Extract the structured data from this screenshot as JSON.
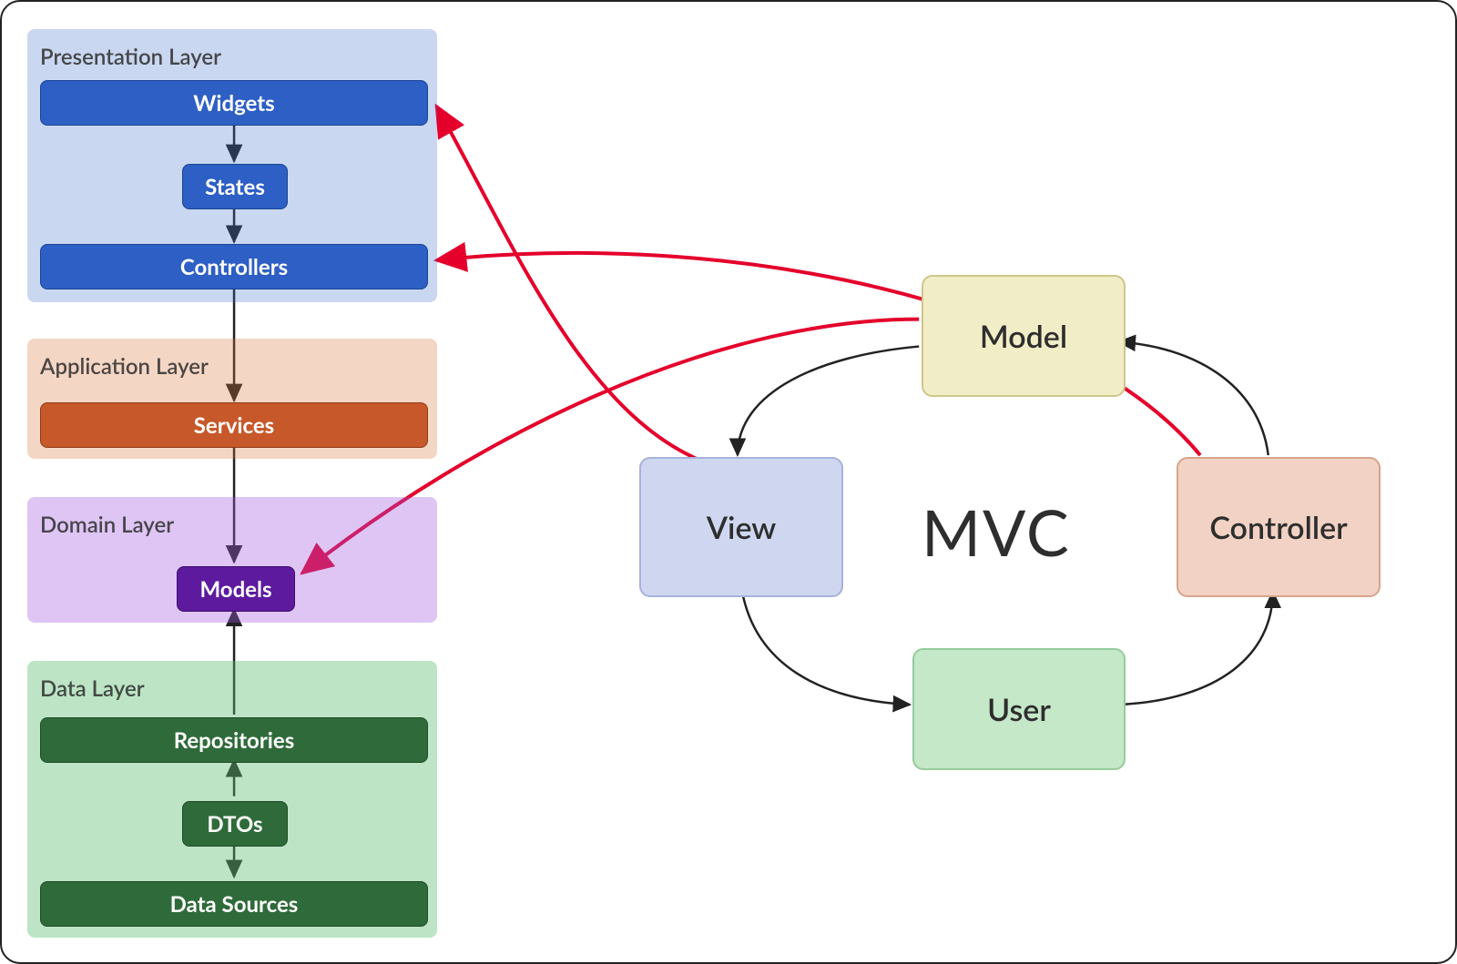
{
  "layers": {
    "presentation": {
      "title": "Presentation Layer",
      "widgets": "Widgets",
      "states": "States",
      "controllers": "Controllers"
    },
    "application": {
      "title": "Application Layer",
      "services": "Services"
    },
    "domain": {
      "title": "Domain Layer",
      "models": "Models"
    },
    "data": {
      "title": "Data Layer",
      "repositories": "Repositories",
      "dtos": "DTOs",
      "sources": "Data Sources"
    }
  },
  "mvc": {
    "label": "MVC",
    "model": "Model",
    "view": "View",
    "controller": "Controller",
    "user": "User"
  },
  "mapping_arrows_description": [
    "Controller (MVC) maps to Controllers in Presentation Layer",
    "View (MVC) maps to Widgets in Presentation Layer",
    "Model (MVC) maps to Models in Domain Layer"
  ],
  "mvc_flow_arrows": [
    "Model → View",
    "View → User",
    "User → Controller",
    "Controller → Model"
  ],
  "layered_flow_arrows": [
    "Widgets → States",
    "States → Controllers",
    "Controllers → Services",
    "Services → Models",
    "Repositories → Models",
    "DTOs → Repositories",
    "DTOs → Data Sources"
  ]
}
